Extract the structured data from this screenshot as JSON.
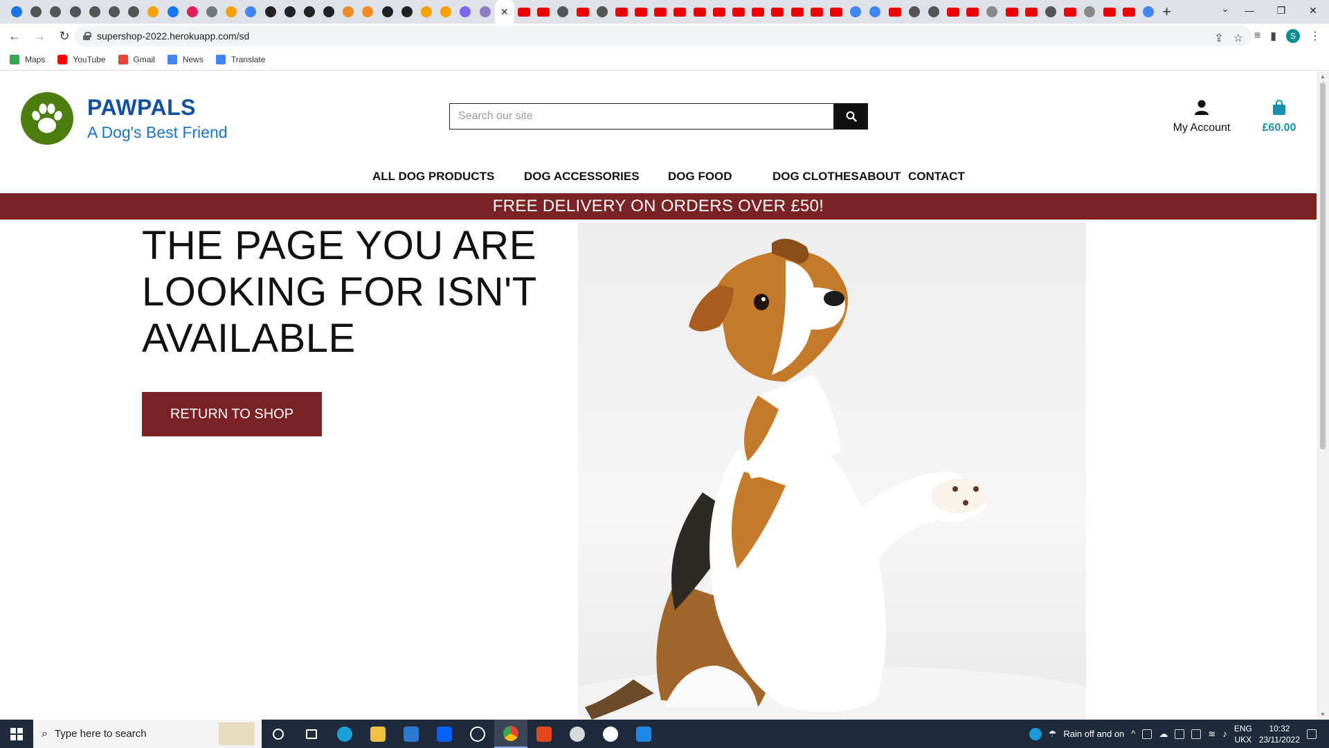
{
  "browser": {
    "url": "supershop-2022.herokuapp.com/sd",
    "profile_initial": "S",
    "bookmarks": [
      {
        "label": "Maps",
        "color": "#34a853"
      },
      {
        "label": "YouTube",
        "color": "#ff0000"
      },
      {
        "label": "Gmail",
        "color": "#ea4335"
      },
      {
        "label": "News",
        "color": "#4285f4"
      },
      {
        "label": "Translate",
        "color": "#4285f4"
      }
    ]
  },
  "site": {
    "brand_name": "PAWPALS",
    "brand_tagline": "A Dog's Best Friend",
    "search_placeholder": "Search our site",
    "account_label": "My Account",
    "bag_total": "£60.00",
    "nav": [
      "ALL DOG PRODUCTS",
      "DOG ACCESSORIES",
      "DOG FOOD",
      "DOG CLOTHES",
      "ABOUT",
      "CONTACT"
    ],
    "promo": "FREE DELIVERY ON ORDERS OVER £50!",
    "error_title": "THE PAGE YOU ARE LOOKING FOR ISN'T AVAILABLE",
    "return_button": "RETURN TO SHOP",
    "colors": {
      "brand_blue": "#1450a0",
      "accent_maroon": "#7b2324",
      "logo_green": "#4d7c11",
      "bag_teal": "#1a8fb0"
    }
  },
  "taskbar": {
    "search_placeholder": "Type here to search",
    "weather": "Rain off and on",
    "lang_top": "ENG",
    "lang_bottom": "UKX",
    "time": "10:32",
    "date": "23/11/2022"
  }
}
